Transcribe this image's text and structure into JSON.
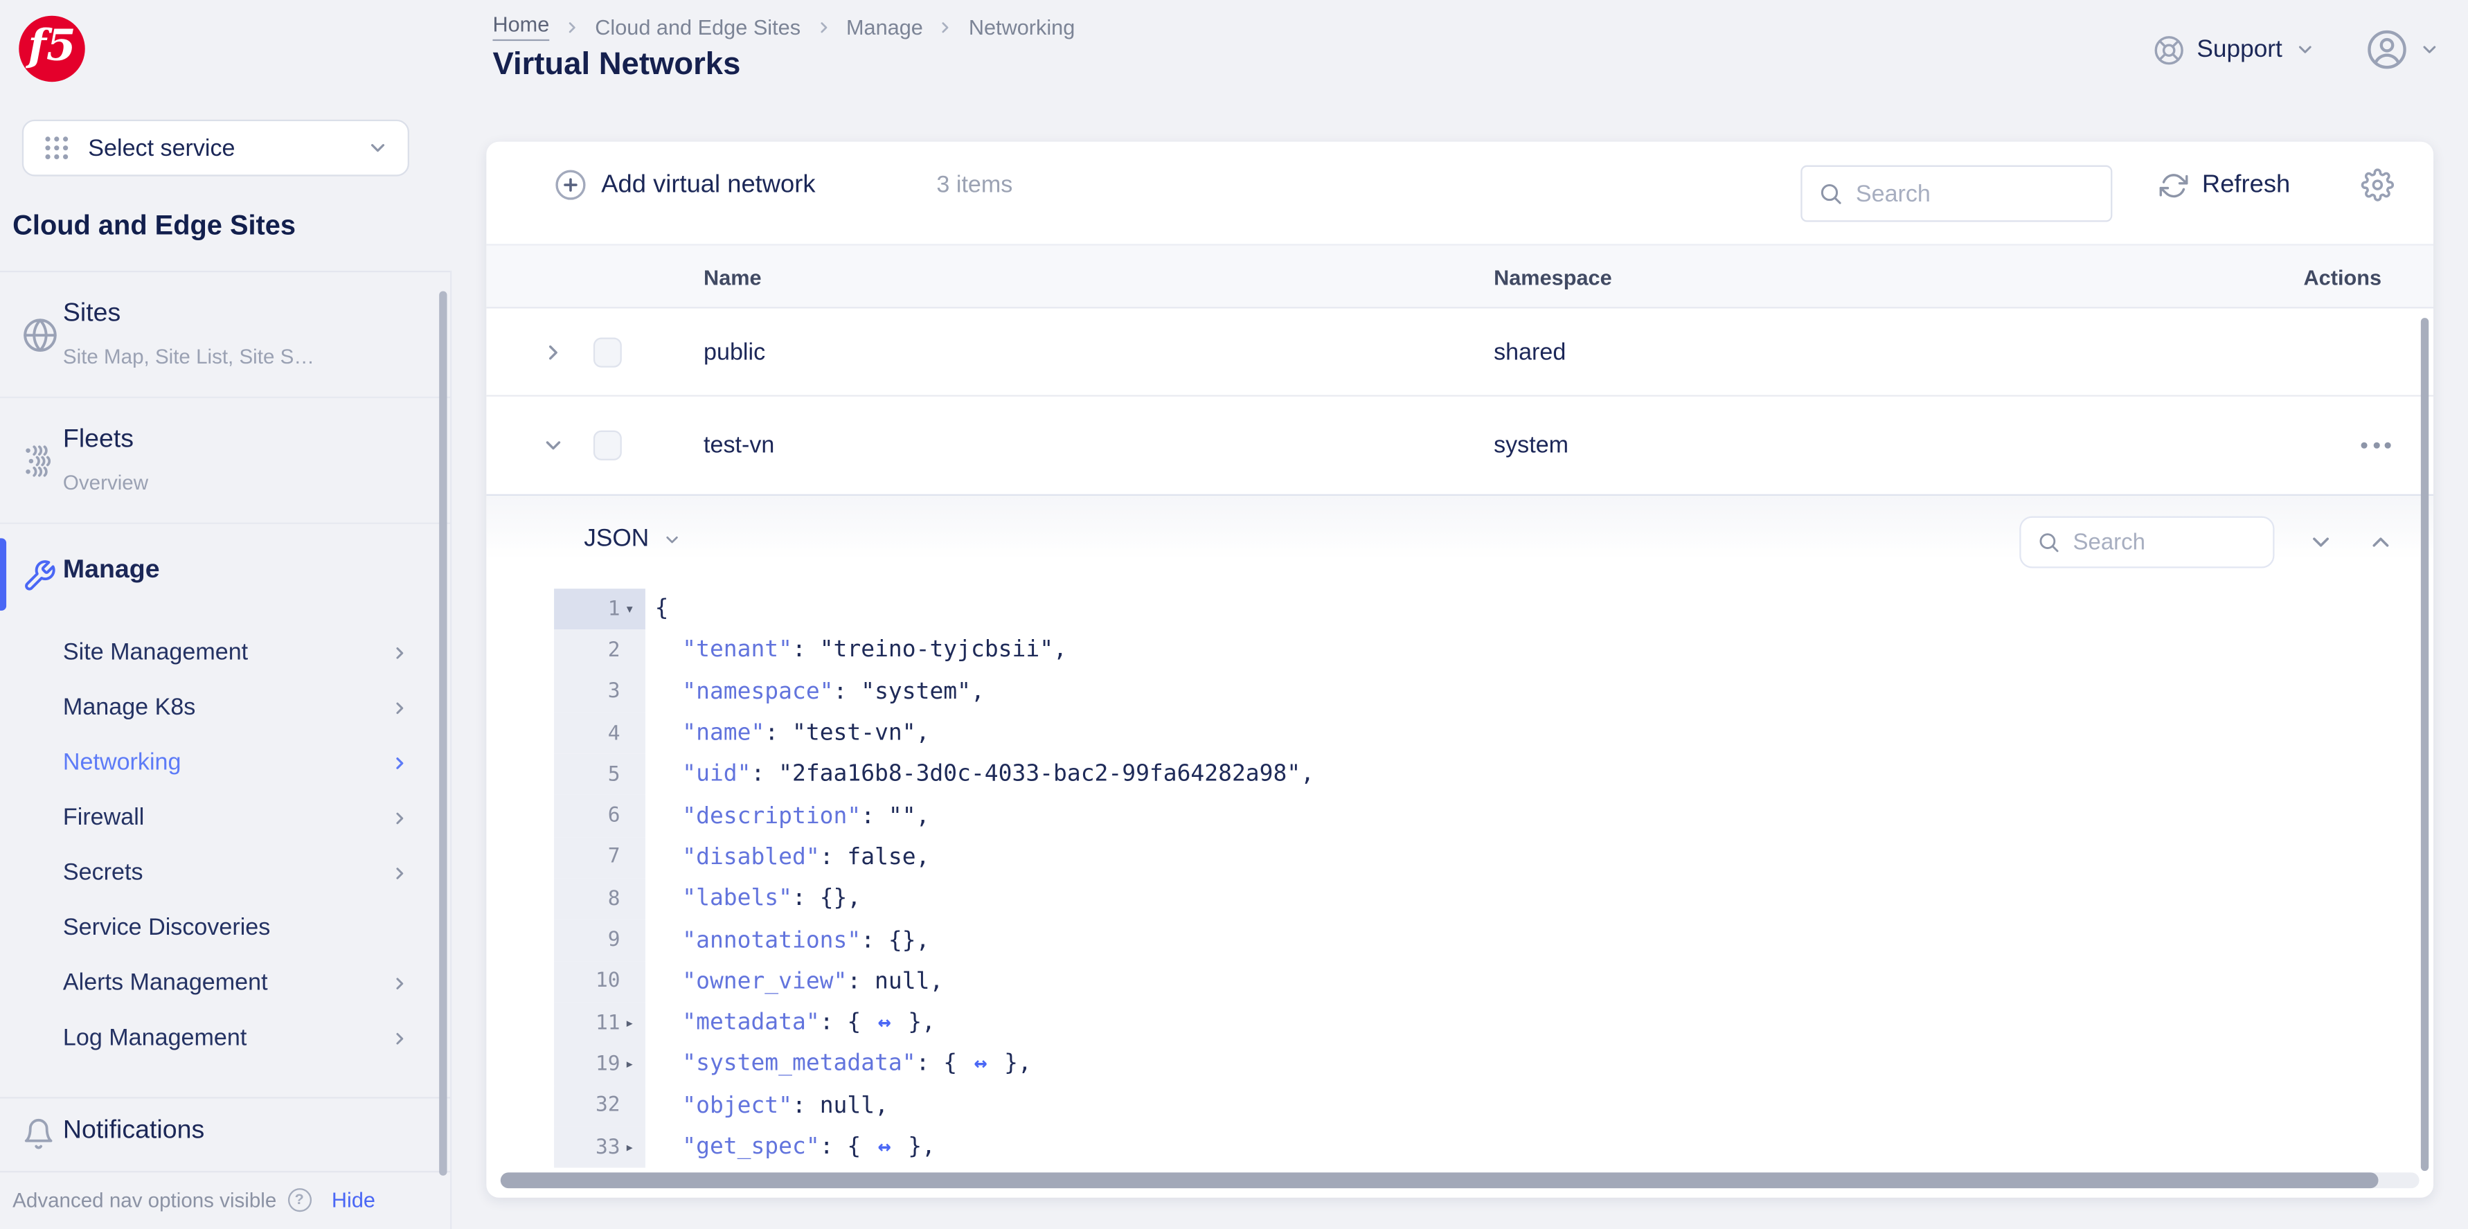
{
  "colors": {
    "brand_red": "#e4002b",
    "accent_blue": "#4a67f5",
    "link_blue": "#5d7bf7",
    "navy": "#1b2757",
    "json_key_blue": "#6274dd",
    "icon_gray": "#98a0b4",
    "page_bg": "#f1f2f6"
  },
  "sidebar": {
    "logo_text": "f5",
    "service_selector_label": "Select service",
    "section_title": "Cloud and Edge Sites",
    "groups": [
      {
        "label": "Sites",
        "subtitle": "Site Map, Site List, Site S…"
      },
      {
        "label": "Fleets",
        "subtitle": "Overview"
      },
      {
        "label": "Manage",
        "subtitle": ""
      }
    ],
    "manage_items": [
      {
        "label": "Site Management"
      },
      {
        "label": "Manage K8s"
      },
      {
        "label": "Networking"
      },
      {
        "label": "Firewall"
      },
      {
        "label": "Secrets"
      },
      {
        "label": "Service Discoveries"
      },
      {
        "label": "Alerts Management"
      },
      {
        "label": "Log Management"
      }
    ],
    "notifications_label": "Notifications",
    "footer": {
      "text": "Advanced nav options visible",
      "hide_label": "Hide"
    }
  },
  "header": {
    "breadcrumb": [
      "Home",
      "Cloud and Edge Sites",
      "Manage",
      "Networking"
    ],
    "title": "Virtual Networks",
    "support_label": "Support"
  },
  "toolbar": {
    "add_label": "Add virtual network",
    "items_count": "3 items",
    "search_placeholder": "Search",
    "refresh_label": "Refresh"
  },
  "table": {
    "columns": [
      "Name",
      "Namespace",
      "Actions"
    ],
    "rows": [
      {
        "name": "public",
        "namespace": "shared"
      },
      {
        "name": "test-vn",
        "namespace": "system"
      }
    ]
  },
  "json_panel": {
    "format_label": "JSON",
    "search_placeholder": "Search",
    "lines": [
      {
        "num": "1",
        "gutter_arrow": "▾",
        "key": "",
        "pre": "{",
        "fold": "",
        "post": ""
      },
      {
        "num": "2",
        "gutter_arrow": "",
        "key": "  \"tenant\"",
        "pre": ": \"treino-tyjcbsii\",",
        "fold": "",
        "post": ""
      },
      {
        "num": "3",
        "gutter_arrow": "",
        "key": "  \"namespace\"",
        "pre": ": \"system\",",
        "fold": "",
        "post": ""
      },
      {
        "num": "4",
        "gutter_arrow": "",
        "key": "  \"name\"",
        "pre": ": \"test-vn\",",
        "fold": "",
        "post": ""
      },
      {
        "num": "5",
        "gutter_arrow": "",
        "key": "  \"uid\"",
        "pre": ": \"2faa16b8-3d0c-4033-bac2-99fa64282a98\",",
        "fold": "",
        "post": ""
      },
      {
        "num": "6",
        "gutter_arrow": "",
        "key": "  \"description\"",
        "pre": ": \"\",",
        "fold": "",
        "post": ""
      },
      {
        "num": "7",
        "gutter_arrow": "",
        "key": "  \"disabled\"",
        "pre": ": false,",
        "fold": "",
        "post": ""
      },
      {
        "num": "8",
        "gutter_arrow": "",
        "key": "  \"labels\"",
        "pre": ": {},",
        "fold": "",
        "post": ""
      },
      {
        "num": "9",
        "gutter_arrow": "",
        "key": "  \"annotations\"",
        "pre": ": {},",
        "fold": "",
        "post": ""
      },
      {
        "num": "10",
        "gutter_arrow": "",
        "key": "  \"owner_view\"",
        "pre": ": null,",
        "fold": "",
        "post": ""
      },
      {
        "num": "11",
        "gutter_arrow": "▸",
        "key": "  \"metadata\"",
        "pre": ": { ",
        "fold": "↔",
        "post": " },"
      },
      {
        "num": "19",
        "gutter_arrow": "▸",
        "key": "  \"system_metadata\"",
        "pre": ": { ",
        "fold": "↔",
        "post": " },"
      },
      {
        "num": "32",
        "gutter_arrow": "",
        "key": "  \"object\"",
        "pre": ": null,",
        "fold": "",
        "post": ""
      },
      {
        "num": "33",
        "gutter_arrow": "▸",
        "key": "  \"get_spec\"",
        "pre": ": { ",
        "fold": "↔",
        "post": " },"
      }
    ]
  }
}
